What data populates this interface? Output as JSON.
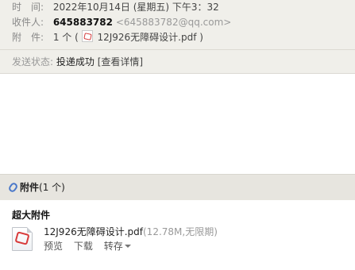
{
  "mail": {
    "time_label": "时　间:",
    "time_value": "2022年10月14日 (星期五) 下午3：32",
    "to_label": "收件人:",
    "to_name": "645883782",
    "to_email": "<645883782@qq.com>",
    "attach_label": "附　件:",
    "attach_prefix": "1 个 (",
    "attach_file": "12J926无障碍设计.pdf",
    "attach_suffix": ")",
    "status_label": "发送状态:",
    "status_value": "投递成功",
    "status_detail": "[查看详情]"
  },
  "attachments": {
    "header_title": "附件",
    "header_count": "(1 个)",
    "section_title": "超大附件",
    "file_name": "12J926无障碍设计.pdf",
    "file_meta": "(12.78M,无限期)",
    "action_preview": "预览",
    "action_download": "下载",
    "action_save": "转存"
  },
  "icons": {
    "inline_file": "pdf-icon",
    "paperclip": "paperclip-icon",
    "file_large": "pdf-file-icon",
    "dropdown": "chevron-down-icon"
  },
  "colors": {
    "header_bg": "#f0efea",
    "attachments_bar_bg": "#e7e5df",
    "pdf_red": "#d83b3b",
    "clip_blue": "#4a78c9"
  }
}
